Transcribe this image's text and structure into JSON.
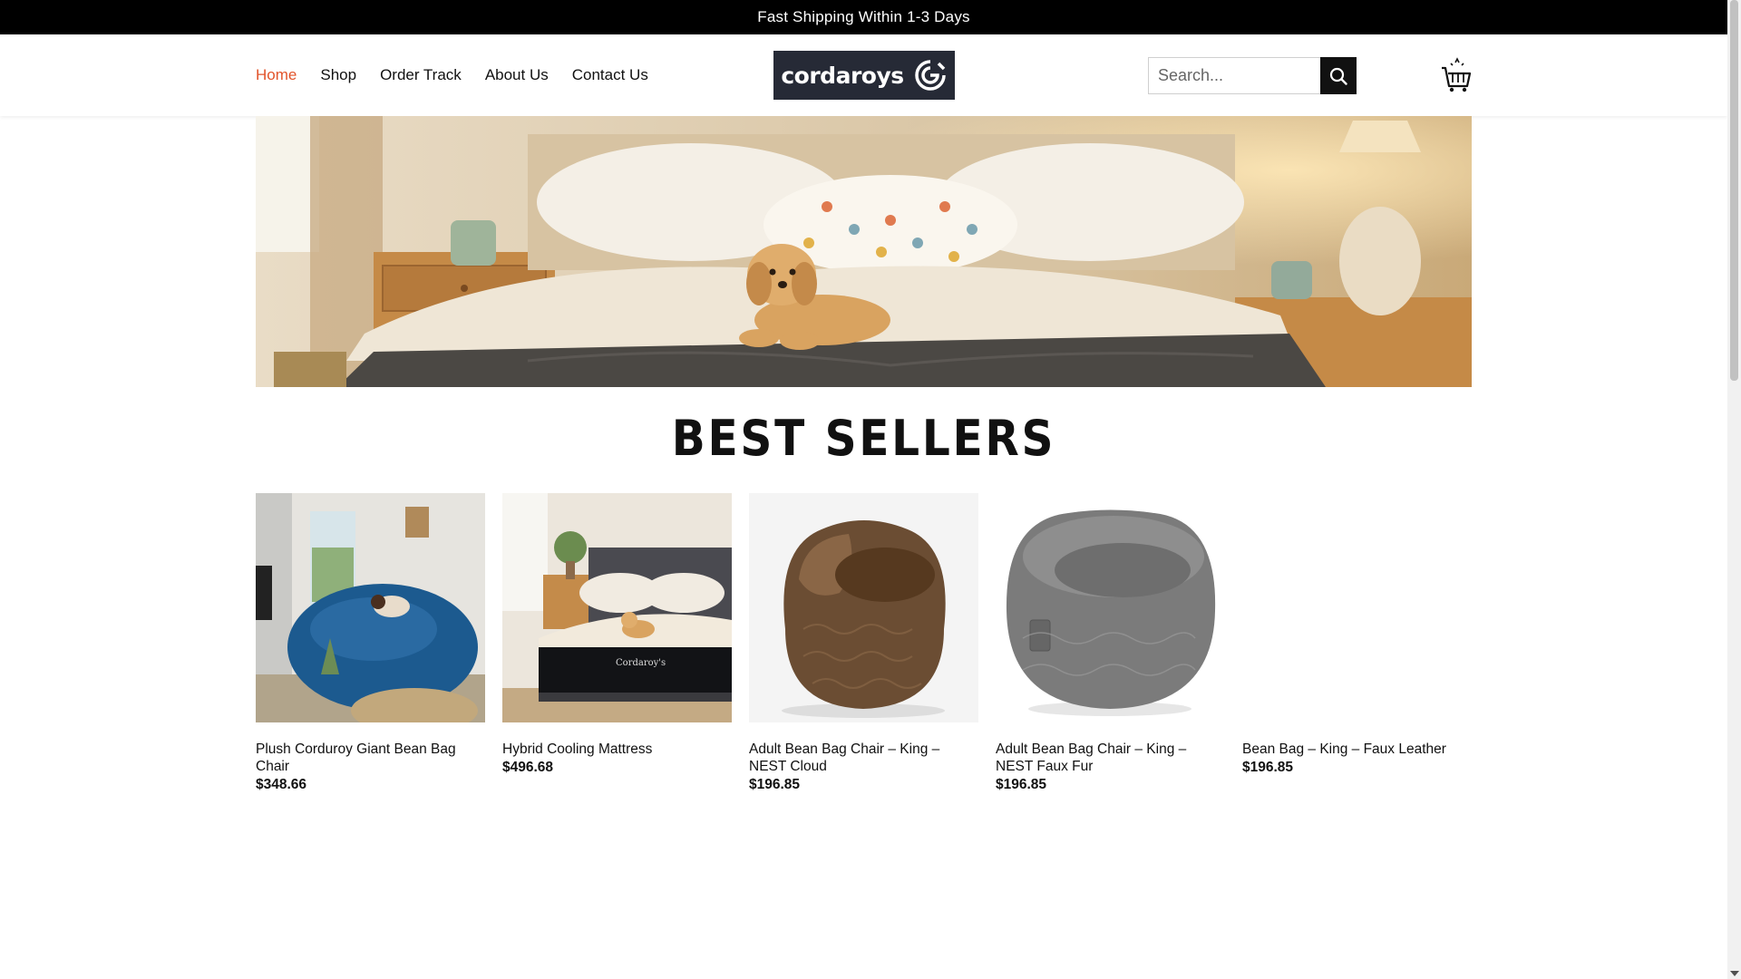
{
  "announcement": "Fast Shipping Within 1-3 Days",
  "nav": {
    "items": [
      {
        "label": "Home",
        "active": true
      },
      {
        "label": "Shop",
        "active": false
      },
      {
        "label": "Order Track",
        "active": false
      },
      {
        "label": "About Us",
        "active": false
      },
      {
        "label": "Contact Us",
        "active": false
      }
    ]
  },
  "logo": {
    "text": "cordaroys",
    "icon": "cordaroys-logo-icon"
  },
  "search": {
    "placeholder": "Search...",
    "icon": "search-icon"
  },
  "cart": {
    "icon": "cart-icon"
  },
  "section": {
    "title": "BEST SELLERS"
  },
  "products": [
    {
      "name": "Plush Corduroy Giant Bean Bag Chair",
      "price": "$348.66"
    },
    {
      "name": "Hybrid Cooling Mattress",
      "price": "$496.68"
    },
    {
      "name": "Adult Bean Bag Chair – King – NEST Cloud",
      "price": "$196.85"
    },
    {
      "name": "Adult Bean Bag Chair – King – NEST Faux Fur",
      "price": "$196.85"
    },
    {
      "name": "Bean Bag – King – Faux Leather",
      "price": "$196.85"
    }
  ],
  "colors": {
    "accent": "#e2542b",
    "topbar": "#000000",
    "logo_bg": "#262a36"
  }
}
